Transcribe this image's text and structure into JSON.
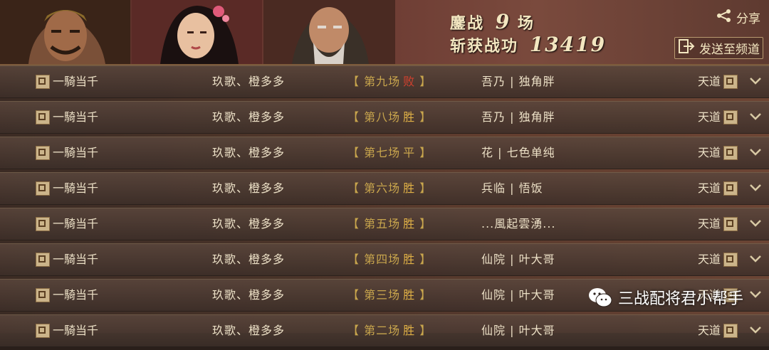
{
  "header": {
    "battle_line1_prefix": "鏖战",
    "battle_count": "9",
    "battle_line1_suffix": "场",
    "battle_line2_prefix": "斩获战功",
    "merit": "13419",
    "share_label": "分享",
    "send_label": "发送至频道"
  },
  "rows": [
    {
      "team_left": "一騎当千",
      "players_left": "玖歌、橙多多",
      "round_label": "【 第九场",
      "result": "败",
      "result_type": "loss",
      "round_end": "】",
      "players_right": "吾乃 | 独角胖",
      "team_right": "天道"
    },
    {
      "team_left": "一騎当千",
      "players_left": "玖歌、橙多多",
      "round_label": "【 第八场",
      "result": "胜",
      "result_type": "win",
      "round_end": "】",
      "players_right": "吾乃 | 独角胖",
      "team_right": "天道"
    },
    {
      "team_left": "一騎当千",
      "players_left": "玖歌、橙多多",
      "round_label": "【 第七场",
      "result": "平",
      "result_type": "draw",
      "round_end": "】",
      "players_right": "花 | 七色单纯",
      "team_right": "天道"
    },
    {
      "team_left": "一騎当千",
      "players_left": "玖歌、橙多多",
      "round_label": "【 第六场",
      "result": "胜",
      "result_type": "win",
      "round_end": "】",
      "players_right": "兵临 | 悟饭",
      "team_right": "天道"
    },
    {
      "team_left": "一騎当千",
      "players_left": "玖歌、橙多多",
      "round_label": "【 第五场",
      "result": "胜",
      "result_type": "win",
      "round_end": "】",
      "players_right": "...風起雲湧...",
      "team_right": "天道"
    },
    {
      "team_left": "一騎当千",
      "players_left": "玖歌、橙多多",
      "round_label": "【 第四场",
      "result": "胜",
      "result_type": "win",
      "round_end": "】",
      "players_right": "仙院 | 叶大哥",
      "team_right": "天道"
    },
    {
      "team_left": "一騎当千",
      "players_left": "玖歌、橙多多",
      "round_label": "【 第三场",
      "result": "胜",
      "result_type": "win",
      "round_end": "】",
      "players_right": "仙院 | 叶大哥",
      "team_right": "天道"
    },
    {
      "team_left": "一騎当千",
      "players_left": "玖歌、橙多多",
      "round_label": "【 第二场",
      "result": "胜",
      "result_type": "win",
      "round_end": "】",
      "players_right": "仙院 | 叶大哥",
      "team_right": "天道"
    }
  ],
  "watermark": {
    "text": "三战配将君小帮手"
  },
  "colors": {
    "loss": "#d2402e",
    "win": "#e0b146",
    "draw": "#c9a64d"
  },
  "icons": {
    "team_badge": "seal-icon",
    "expand": "chevron-down-icon",
    "share": "share-icon",
    "send": "send-to-channel-icon"
  }
}
